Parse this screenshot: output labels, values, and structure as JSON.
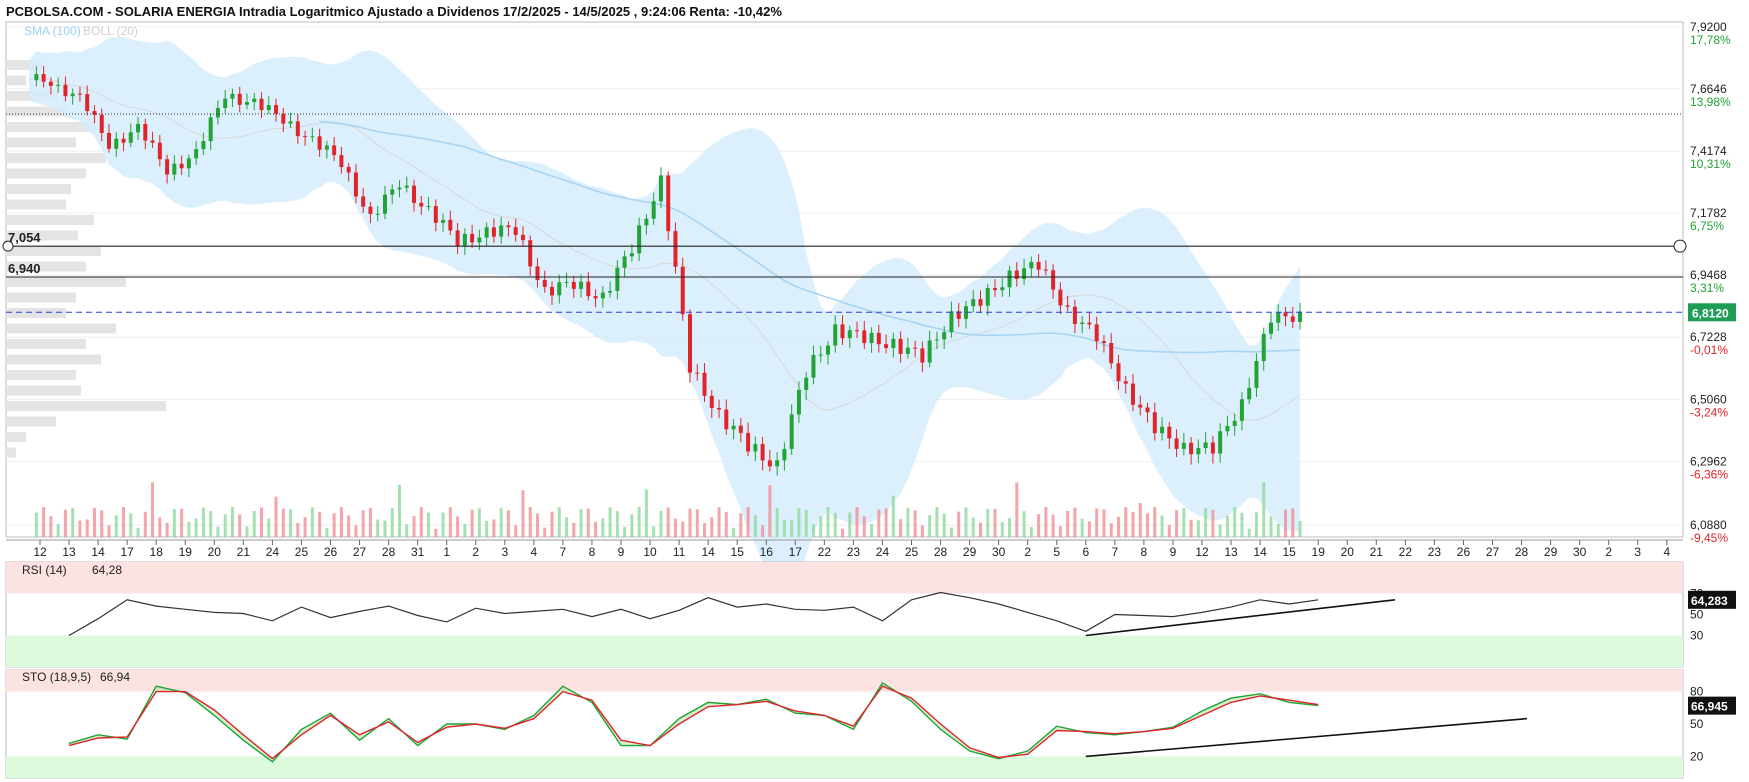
{
  "header": {
    "title": "PCBOLSA.COM - SOLARIA ENERGIA Intradia Logaritmico Ajustado a Dividenos 17/2/2025 - 14/5/2025 , 9:24:06 Renta: -10,42%"
  },
  "colors": {
    "up": "#21a336",
    "down": "#e0242c",
    "band": "#d6ecfb",
    "sma": "#a8d4f2",
    "last_price_box": "#1f9d55",
    "overbought_zone": "#fde2e2",
    "oversold_zone": "#dcfadc"
  },
  "chart_data": [
    {
      "type": "candlestick",
      "title": "SOLARIA ENERGIA",
      "scale": "log",
      "indicators": [
        "SMA (100)",
        "BOLL (20)"
      ],
      "y_ticks": [
        "7,9200",
        "7,6646",
        "7,4174",
        "7,1782",
        "6,9468",
        "6,7228",
        "6,5060",
        "6,2962",
        "6,0880"
      ],
      "y_pct": [
        "17,78%",
        "13,98%",
        "10,31%",
        "6,75%",
        "3,31%",
        "-0,01%",
        "-3,24%",
        "-6,36%",
        "-9,45%"
      ],
      "x_ticks": [
        "12",
        "13",
        "14",
        "17",
        "18",
        "19",
        "20",
        "21",
        "24",
        "25",
        "26",
        "27",
        "28",
        "31",
        "1",
        "2",
        "3",
        "4",
        "7",
        "8",
        "9",
        "10",
        "11",
        "14",
        "15",
        "16",
        "17",
        "22",
        "23",
        "24",
        "25",
        "28",
        "29",
        "30",
        "2",
        "5",
        "6",
        "7",
        "8",
        "9",
        "12",
        "13",
        "14",
        "15",
        "19",
        "20",
        "21",
        "22",
        "23",
        "26",
        "27",
        "28",
        "29",
        "30",
        "2",
        "3",
        "4"
      ],
      "horizontal_lines": [
        {
          "label": "7,054",
          "value": 7.054
        },
        {
          "label": "6,940",
          "value": 6.94
        }
      ],
      "last_price": {
        "label": "6,8120",
        "value": 6.812
      },
      "daily_close": [
        7.7,
        7.62,
        7.45,
        7.5,
        7.35,
        7.4,
        7.65,
        7.6,
        7.55,
        7.45,
        7.38,
        7.15,
        7.3,
        7.18,
        7.08,
        7.1,
        7.12,
        6.88,
        6.92,
        6.86,
        7.05,
        7.3,
        6.62,
        6.45,
        6.35,
        6.28,
        6.6,
        6.75,
        6.72,
        6.7,
        6.65,
        6.8,
        6.85,
        6.95,
        6.98,
        6.82,
        6.72,
        6.55,
        6.4,
        6.35,
        6.33,
        6.5,
        6.78,
        6.81
      ],
      "rsi": {
        "label": "RSI (14)",
        "value": "64,28",
        "last": "64,283",
        "levels": [
          "70",
          "50",
          "30"
        ],
        "series": [
          30,
          46,
          64,
          58,
          55,
          52,
          51,
          44,
          57,
          47,
          53,
          58,
          49,
          43,
          56,
          51,
          53,
          55,
          48,
          55,
          46,
          54,
          66,
          57,
          60,
          55,
          54,
          57,
          44,
          64,
          71,
          66,
          60,
          52,
          44,
          34,
          50,
          49,
          48,
          52,
          57,
          64,
          60,
          64
        ]
      },
      "sto": {
        "label": "STO (18,9,5)",
        "value": "66,94",
        "last": "66,945",
        "levels": [
          "80",
          "50",
          "20"
        ],
        "k": [
          32,
          40,
          36,
          85,
          79,
          58,
          35,
          15,
          45,
          60,
          35,
          55,
          30,
          50,
          50,
          45,
          58,
          85,
          70,
          30,
          30,
          55,
          70,
          68,
          73,
          60,
          58,
          45,
          88,
          71,
          45,
          25,
          18,
          25,
          48,
          42,
          40,
          43,
          47,
          62,
          74,
          78,
          70,
          67
        ],
        "d": [
          30,
          37,
          38,
          80,
          80,
          63,
          40,
          18,
          40,
          58,
          40,
          52,
          33,
          47,
          50,
          46,
          55,
          80,
          72,
          35,
          30,
          50,
          66,
          68,
          71,
          62,
          58,
          48,
          85,
          74,
          50,
          28,
          19,
          22,
          44,
          43,
          41,
          43,
          46,
          58,
          70,
          76,
          72,
          68
        ]
      }
    }
  ]
}
